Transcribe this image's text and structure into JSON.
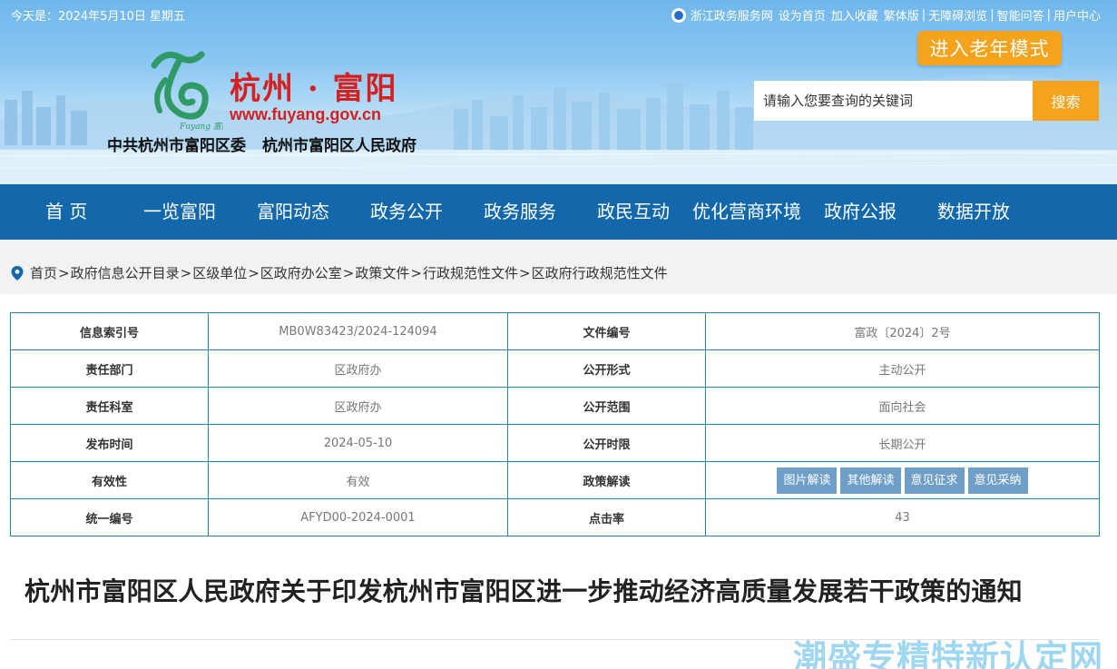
{
  "topbar": {
    "date": "今天是：2024年5月10日 星期五",
    "links": [
      "浙江政务服务网",
      "设为首页",
      "加入收藏",
      "繁体版",
      "无障碍浏览",
      "智能问答",
      "用户中心"
    ]
  },
  "header": {
    "elder_mode_label": "进入老年模式",
    "site_title": "杭州 · 富阳",
    "site_url": "www.fuyang.gov.cn",
    "logo_small_text": "Fuyang 富阳",
    "org_party": "中共杭州市富阳区委",
    "org_gov": "杭州市富阳区人民政府",
    "search_placeholder": "请输入您要查询的关键词",
    "search_button": "搜索"
  },
  "nav": {
    "items": [
      "首 页",
      "一览富阳",
      "富阳动态",
      "政务公开",
      "政务服务",
      "政民互动",
      "优化营商环境",
      "政府公报",
      "数据开放"
    ]
  },
  "breadcrumb": {
    "items": [
      "首页",
      "政府信息公开目录",
      "区级单位",
      "区政府办公室",
      "政策文件",
      "行政规范性文件",
      "区政府行政规范性文件"
    ],
    "separator": ">"
  },
  "info": {
    "rows": [
      {
        "l1": "信息索引号",
        "v1": "MB0W83423/2024-124094",
        "l2": "文件编号",
        "v2": "富政〔2024〕2号"
      },
      {
        "l1": "责任部门",
        "v1": "区政府办",
        "l2": "公开形式",
        "v2": "主动公开"
      },
      {
        "l1": "责任科室",
        "v1": "区政府办",
        "l2": "公开范围",
        "v2": "面向社会"
      },
      {
        "l1": "发布时间",
        "v1": "2024-05-10",
        "l2": "公开时限",
        "v2": "长期公开"
      },
      {
        "l1": "有效性",
        "v1": "有效",
        "l2": "政策解读",
        "tags": [
          "图片解读",
          "其他解读",
          "意见征求",
          "意见采纳"
        ]
      },
      {
        "l1": "统一编号",
        "v1": "AFYD00-2024-0001",
        "l2": "点击率",
        "v2": "43"
      }
    ]
  },
  "document": {
    "title": "杭州市富阳区人民政府关于印发杭州市富阳区进一步推动经济高质量发展若干政策的通知"
  },
  "watermark": "潮盛专精特新认定网",
  "colors": {
    "nav_bg": "#1367ab",
    "accent_orange": "#f5a31c",
    "title_red": "#d42020",
    "table_border": "#2b7fc4",
    "tag_bg": "#6f9fc9"
  }
}
